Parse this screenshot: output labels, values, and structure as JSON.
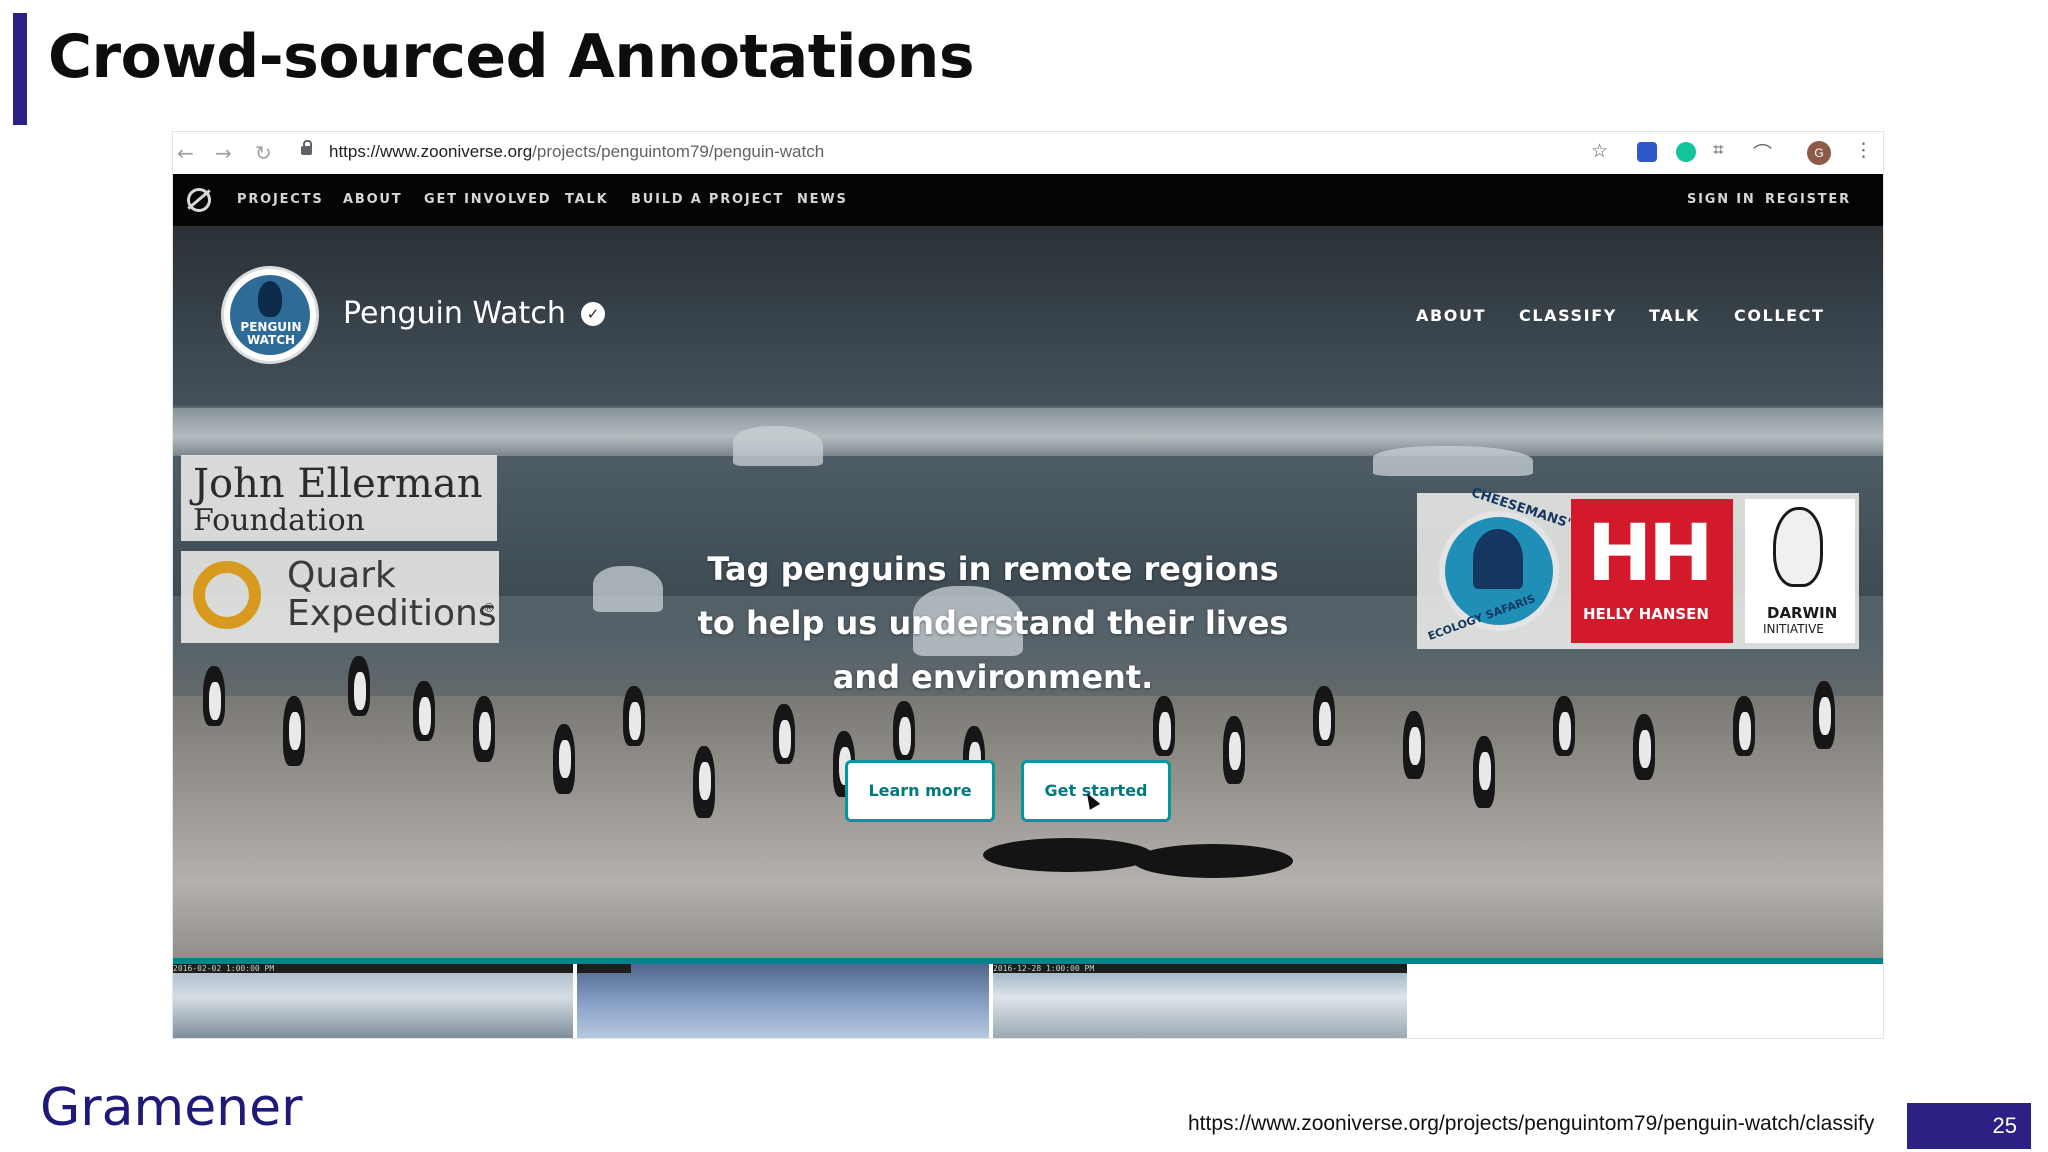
{
  "slide": {
    "title": "Crowd-sourced Annotations",
    "brand": "Gramener",
    "source_url": "https://www.zooniverse.org/projects/penguintom79/penguin-watch/classify",
    "page_number": "25",
    "accent_color": "#2b2185"
  },
  "browser": {
    "url_host": "https://www.zooniverse.org",
    "url_path": "/projects/penguintom79/penguin-watch",
    "profile_initial": "G",
    "icons": [
      "back-icon",
      "forward-icon",
      "reload-icon",
      "lock-icon",
      "star-icon",
      "extension-icon",
      "grammarly-icon",
      "crop-icon",
      "extension-icon",
      "profile-icon",
      "menu-icon"
    ]
  },
  "zooniverse_nav": {
    "items": [
      "PROJECTS",
      "ABOUT",
      "GET INVOLVED",
      "TALK",
      "BUILD A PROJECT",
      "NEWS"
    ],
    "sign_in": "SIGN IN",
    "register": "REGISTER"
  },
  "project": {
    "logo_text": "PENGUIN WATCH",
    "name": "Penguin Watch",
    "nav": [
      "ABOUT",
      "CLASSIFY",
      "TALK",
      "COLLECT"
    ],
    "tagline": "Tag penguins in remote regions to help us understand their lives and environment.",
    "learn_more": "Learn more",
    "get_started": "Get started",
    "teal_color": "#00979d"
  },
  "sponsors": {
    "ellerman_line1": "John Ellerman",
    "ellerman_line2": "Foundation",
    "quark_line1": "Quark",
    "quark_line2": "Expeditions",
    "quark_reg": "®",
    "cheesemans": "CHEESEMANS'",
    "ecology": "ECOLOGY SAFARIS",
    "hh_mark": "HH",
    "hh_name": "HELLY HANSEN",
    "darwin_line1": "DARWIN",
    "darwin_line2": "INITIATIVE"
  },
  "thumbnails": {
    "stamp1": "2016-02-02 1:00:00 PM",
    "stamp3": "2016-12-28 1:00:00 PM"
  }
}
